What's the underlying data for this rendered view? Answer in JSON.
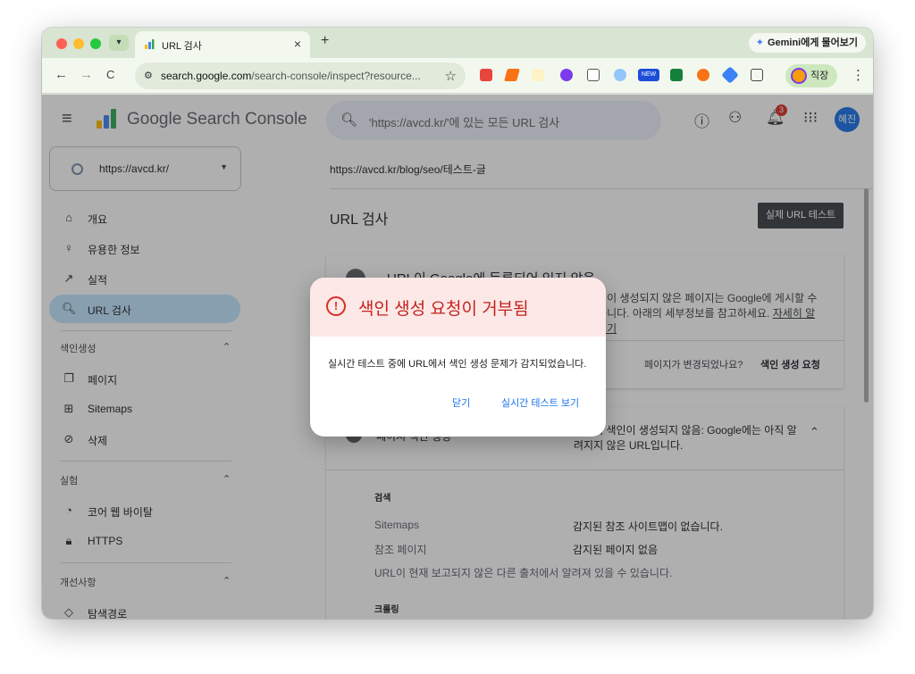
{
  "browser": {
    "tab": {
      "title": "URL 검사",
      "close": "×"
    },
    "new_tab": "+",
    "gemini_label": "Gemini에게 물어보기",
    "nav": {
      "back": "←",
      "forward": "→",
      "reload": "C"
    },
    "address": {
      "host": "search.google.com",
      "path": "/search-console/inspect?resource..."
    },
    "profile_label": "직장",
    "ext_new_badge": "NEW"
  },
  "header": {
    "brand": "Google Search Console",
    "search_placeholder": "'https://avcd.kr/'에 있는 모든 URL 검사",
    "notification_count": "3",
    "avatar_text": "혜진"
  },
  "sidebar": {
    "property": "https://avcd.kr/",
    "top_items": [
      {
        "label": "개요",
        "icon": "home-icon"
      },
      {
        "label": "유용한 정보",
        "icon": "lightbulb-icon"
      },
      {
        "label": "실적",
        "icon": "trending-icon"
      },
      {
        "label": "URL 검사",
        "icon": "search-icon"
      }
    ],
    "sections": [
      {
        "title": "색인생성",
        "items": [
          {
            "label": "페이지"
          },
          {
            "label": "Sitemaps"
          },
          {
            "label": "삭제"
          }
        ]
      },
      {
        "title": "실험",
        "items": [
          {
            "label": "코어 웹 바이탈"
          },
          {
            "label": "HTTPS"
          }
        ]
      },
      {
        "title": "개선사항",
        "items": [
          {
            "label": "탐색경로"
          }
        ]
      }
    ]
  },
  "main": {
    "breadcrumb": "https://avcd.kr/blog/seo/테스트-글",
    "title": "URL 검사",
    "live_test_label": "실제 URL 테스트",
    "status_card": {
      "title": "URL이 Google에 등록되어 있지 않음",
      "description": "색인이 생성되지 않은 페이지는 Google에 게시할 수 없습니다. 아래의 세부정보를 참고하세요.",
      "learn_more": "자세히 알아보기",
      "question": "페이지가 변경되었나요?",
      "request_label": "색인 생성 요청"
    },
    "index_card": {
      "label": "페이지 색인 생성",
      "status": "페이지 색인이 생성되지 않음: Google에는 아직 알려지지 않은 URL입니다.",
      "discovery_title": "검색",
      "rows": [
        {
          "key": "Sitemaps",
          "value": "감지된 참조 사이트맵이 없습니다."
        },
        {
          "key": "참조 페이지",
          "value": "감지된 페이지 없음"
        }
      ],
      "note": "URL이 현재 보고되지 않은 다른 출처에서 알려져 있을 수 있습니다.",
      "crawl_title": "크롤링"
    }
  },
  "dialog": {
    "title": "색인 생성 요청이 거부됨",
    "body": "실시간 테스트 중에 URL에서 색인 생성 문제가 감지되었습니다.",
    "close_label": "닫기",
    "view_live_label": "실시간 테스트 보기"
  },
  "colors": {
    "accent": "#1a73e8",
    "error": "#d93025",
    "active_nav": "#c2e7ff"
  }
}
